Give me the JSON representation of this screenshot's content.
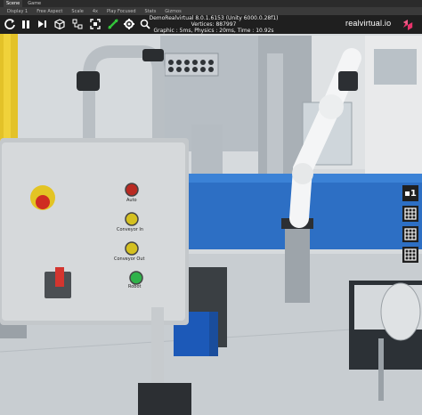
{
  "editor": {
    "tabs": [
      "Scene",
      "Game"
    ],
    "bar": [
      "Display 1",
      "Free Aspect",
      "Scale",
      "4x",
      "Play Focused",
      "Stats",
      "Gizmos"
    ]
  },
  "toolbar": {
    "icons": [
      "reload-icon",
      "pause-icon",
      "step-icon",
      "cube-icon",
      "hierarchy-icon",
      "layers-icon",
      "expand-icon",
      "signal-icon",
      "gear-icon",
      "search-icon"
    ]
  },
  "stats": {
    "line1": "DemoRealvirtual 8.0.1.6153 (Unity 6000.0.28f1)",
    "line2": "Vertices: 887997",
    "line3": "Graphic : 5ms, Physics : 20ms, Time : 10.92s"
  },
  "brand": {
    "name": "realvirtual.io",
    "logo_color": "#e8336b"
  },
  "sidepanel": {
    "top_label": "▪1"
  },
  "panel": {
    "auto": "Auto",
    "conveyor_in": "Conveyor In",
    "conveyor_out": "Conveyor Out",
    "robot": "Robot"
  }
}
